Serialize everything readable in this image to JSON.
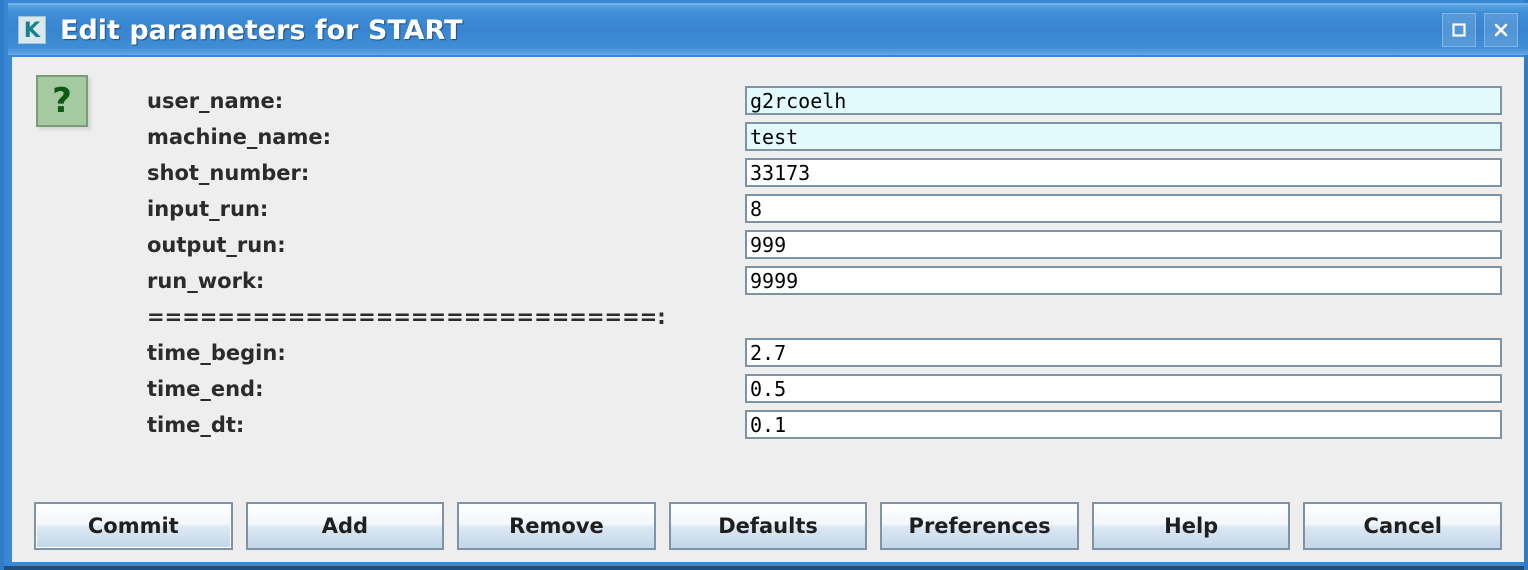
{
  "window": {
    "title": "Edit parameters for START",
    "app_icon": "kepler-k-icon",
    "controls": [
      {
        "name": "maximize-button",
        "icon": "maximize-icon"
      },
      {
        "name": "close-button",
        "icon": "close-icon"
      }
    ],
    "accent_color": "#3884d0",
    "body_background": "#eeeeee"
  },
  "help": {
    "icon": "question-mark-icon",
    "label": "?",
    "background": "#a5c9a0",
    "foreground": "#0e5a14"
  },
  "form": {
    "rows": [
      {
        "label": "user_name:",
        "value": "g2rcoelh",
        "tinted": true,
        "type": "field"
      },
      {
        "label": "machine_name:",
        "value": "test",
        "tinted": true,
        "type": "field"
      },
      {
        "label": "shot_number:",
        "value": "33173",
        "tinted": false,
        "type": "field"
      },
      {
        "label": "input_run:",
        "value": "8",
        "tinted": false,
        "type": "field"
      },
      {
        "label": "output_run:",
        "value": "999",
        "tinted": false,
        "type": "field"
      },
      {
        "label": "run_work:",
        "value": "9999",
        "tinted": false,
        "type": "field"
      },
      {
        "label": "=============================:",
        "value": "",
        "tinted": false,
        "type": "separator"
      },
      {
        "label": "time_begin:",
        "value": "2.7",
        "tinted": false,
        "type": "field"
      },
      {
        "label": "time_end:",
        "value": "0.5",
        "tinted": false,
        "type": "field"
      },
      {
        "label": "time_dt:",
        "value": "0.1",
        "tinted": false,
        "type": "field"
      }
    ],
    "field_background_tinted": "#e2fcfd",
    "field_background_plain": "#ffffff",
    "field_border": "#7f93a8"
  },
  "buttons": [
    {
      "name": "commit-button",
      "label": "Commit"
    },
    {
      "name": "add-button",
      "label": "Add"
    },
    {
      "name": "remove-button",
      "label": "Remove"
    },
    {
      "name": "defaults-button",
      "label": "Defaults"
    },
    {
      "name": "preferences-button",
      "label": "Preferences"
    },
    {
      "name": "help-button",
      "label": "Help"
    },
    {
      "name": "cancel-button",
      "label": "Cancel"
    }
  ]
}
